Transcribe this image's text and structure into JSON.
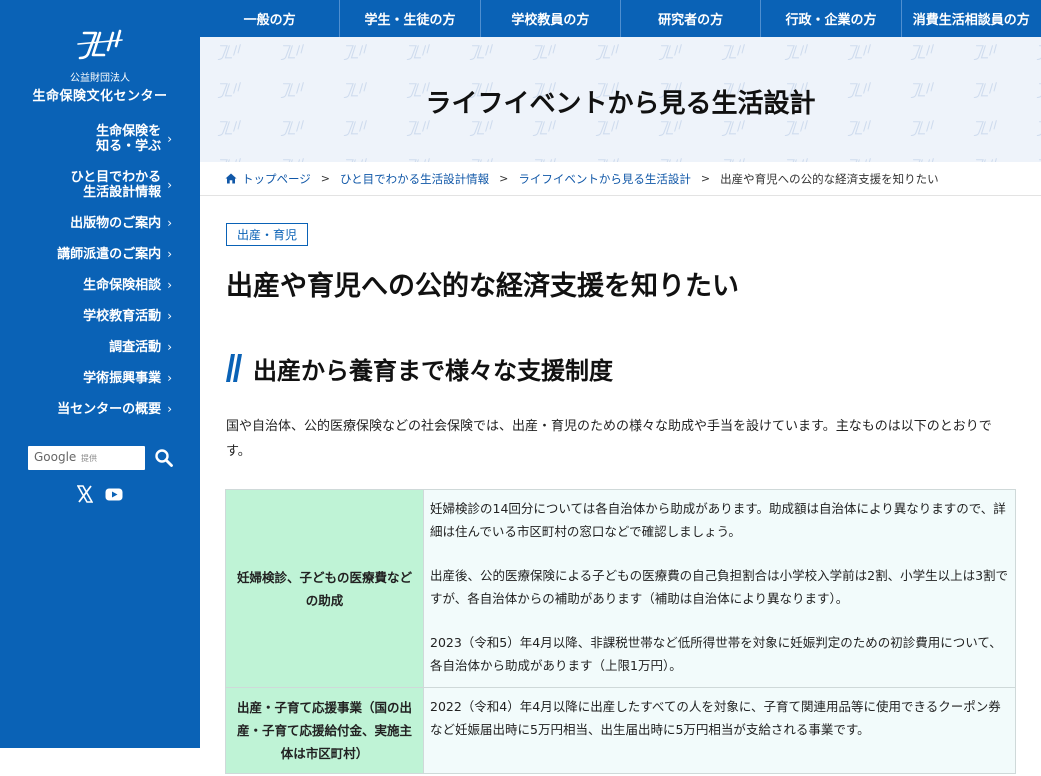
{
  "org": {
    "small_label": "公益財団法人",
    "name": "生命保険文化センター"
  },
  "sidebar": {
    "items": [
      {
        "label": "生命保険を\n知る・学ぶ"
      },
      {
        "label": "ひと目でわかる\n生活設計情報"
      },
      {
        "label": "出版物のご案内"
      },
      {
        "label": "講師派遣のご案内"
      },
      {
        "label": "生命保険相談"
      },
      {
        "label": "学校教育活動"
      },
      {
        "label": "調査活動"
      },
      {
        "label": "学術振興事業"
      },
      {
        "label": "当センターの概要"
      }
    ],
    "search": {
      "brand": "Google",
      "suffix": "提供"
    }
  },
  "topnav": {
    "items": [
      "一般の方",
      "学生・生徒の方",
      "学校教員の方",
      "研究者の方",
      "行政・企業の方",
      "消費生活相談員の方"
    ]
  },
  "hero": {
    "title": "ライフイベントから見る生活設計"
  },
  "breadcrumb": {
    "home": "トップページ",
    "level1": "ひと目でわかる生活設計情報",
    "level2": "ライフイベントから見る生活設計",
    "current": "出産や育児への公的な経済支援を知りたい"
  },
  "content": {
    "tag": "出産・育児",
    "title": "出産や育児への公的な経済支援を知りたい",
    "section_title": "出産から養育まで様々な支援制度",
    "intro": "国や自治体、公的医療保険などの社会保険では、出産・育児のための様々な助成や手当を設けています。主なものは以下のとおりです。",
    "table": [
      {
        "head": "妊婦検診、子どもの医療費などの助成",
        "paragraphs": [
          "妊婦検診の14回分については各自治体から助成があります。助成額は自治体により異なりますので、詳細は住んでいる市区町村の窓口などで確認しましょう。",
          "出産後、公的医療保険による子どもの医療費の自己負担割合は小学校入学前は2割、小学生以上は3割ですが、各自治体からの補助があります（補助は自治体により異なります）。",
          "2023（令和5）年4月以降、非課税世帯など低所得世帯を対象に妊娠判定のための初診費用について、各自治体から助成があります（上限1万円）。"
        ]
      },
      {
        "head": "出産・子育て応援事業（国の出産・子育て応援給付金、実施主体は市区町村）",
        "paragraphs": [
          "2022（令和4）年4月以降に出産したすべての人を対象に、子育て関連用品等に使用できるクーポン券など妊娠届出時に5万円相当、出生届出時に5万円相当が支給される事業です。"
        ]
      }
    ]
  },
  "colors": {
    "brand_blue": "#0a62b6",
    "table_head_green": "#bff3d6",
    "table_body": "#f2fbfb"
  },
  "icons": [
    "jli-logo",
    "chevron-right-icon",
    "search-icon",
    "x-icon",
    "youtube-icon",
    "home-icon",
    "section-slash-icon"
  ]
}
